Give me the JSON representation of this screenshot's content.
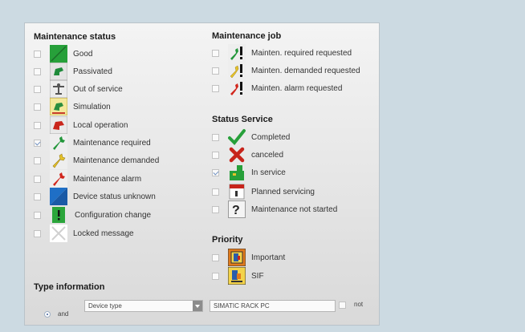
{
  "maintenance_status": {
    "title": "Maintenance status",
    "items": [
      {
        "label": "Good",
        "icon": "good-icon",
        "checked": false
      },
      {
        "label": "Passivated",
        "icon": "passivated-icon",
        "checked": false
      },
      {
        "label": "Out of service",
        "icon": "out-of-service-icon",
        "checked": false
      },
      {
        "label": "Simulation",
        "icon": "simulation-icon",
        "checked": false
      },
      {
        "label": "Local operation",
        "icon": "local-operation-icon",
        "checked": false
      },
      {
        "label": "Maintenance required",
        "icon": "maintenance-required-icon",
        "checked": true
      },
      {
        "label": "Maintenance demanded",
        "icon": "maintenance-demanded-icon",
        "checked": false
      },
      {
        "label": "Maintenance alarm",
        "icon": "maintenance-alarm-icon",
        "checked": false
      },
      {
        "label": "Device status unknown",
        "icon": "device-status-unknown-icon",
        "checked": false
      },
      {
        "label": "Configuration change",
        "icon": "configuration-change-icon",
        "checked": false
      },
      {
        "label": "Locked message",
        "icon": "locked-message-icon",
        "checked": false
      }
    ]
  },
  "maintenance_job": {
    "title": "Maintenance job",
    "items": [
      {
        "label": "Mainten. required requested",
        "icon": "wrench-green-request-icon",
        "checked": false
      },
      {
        "label": "Mainten. demanded requested",
        "icon": "wrench-yellow-request-icon",
        "checked": false
      },
      {
        "label": "Mainten. alarm requested",
        "icon": "wrench-red-request-icon",
        "checked": false
      }
    ]
  },
  "status_service": {
    "title": "Status Service",
    "items": [
      {
        "label": "Completed",
        "icon": "checkmark-icon",
        "checked": false
      },
      {
        "label": "canceled",
        "icon": "cross-icon",
        "checked": false
      },
      {
        "label": "In service",
        "icon": "in-service-icon",
        "checked": true
      },
      {
        "label": "Planned servicing",
        "icon": "calendar-icon",
        "checked": false
      },
      {
        "label": "Maintenance not started",
        "icon": "question-icon",
        "checked": false
      }
    ]
  },
  "priority": {
    "title": "Priority",
    "items": [
      {
        "label": "Important",
        "icon": "important-icon",
        "checked": false
      },
      {
        "label": "SIF",
        "icon": "sif-icon",
        "checked": false
      }
    ]
  },
  "type_information": {
    "title": "Type information",
    "radio_label": "and",
    "dropdown_value": "Device type",
    "text_value": "SIMATIC RACK PC",
    "not_label": "not"
  },
  "colors": {
    "background": "#ccdae2",
    "green": "#2aa53a",
    "red": "#d42a1f",
    "yellow": "#f2d02a",
    "blue": "#1f6cc0"
  }
}
